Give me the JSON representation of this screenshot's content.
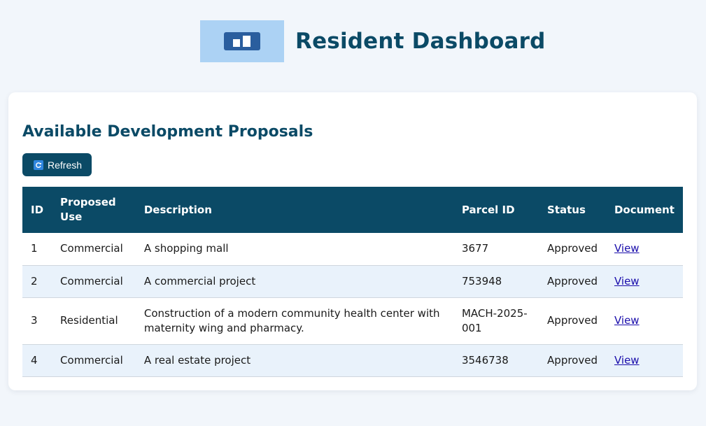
{
  "header": {
    "title": "Resident Dashboard",
    "logo_icon": "dashboard-icon"
  },
  "section": {
    "title": "Available Development Proposals"
  },
  "refresh": {
    "label": "Refresh",
    "icon": "refresh-icon"
  },
  "table": {
    "headers": {
      "id": "ID",
      "use": "Proposed Use",
      "description": "Description",
      "parcel": "Parcel ID",
      "status": "Status",
      "document": "Document"
    },
    "rows": [
      {
        "id": "1",
        "use": "Commercial",
        "description": "A shopping mall",
        "parcel": "3677",
        "status": "Approved",
        "document": "View"
      },
      {
        "id": "2",
        "use": "Commercial",
        "description": "A commercial project",
        "parcel": "753948",
        "status": "Approved",
        "document": "View"
      },
      {
        "id": "3",
        "use": "Residential",
        "description": "Construction of a modern community health center with maternity wing and pharmacy.",
        "parcel": "MACH-2025-001",
        "status": "Approved",
        "document": "View"
      },
      {
        "id": "4",
        "use": "Commercial",
        "description": "A real estate project",
        "parcel": "3546738",
        "status": "Approved",
        "document": "View"
      }
    ]
  },
  "colors": {
    "primary": "#0b4a66",
    "background": "#f2f6fb",
    "logo_bg": "#acd2f4",
    "row_alt": "#e9f2fb",
    "link": "#1a0dab"
  }
}
